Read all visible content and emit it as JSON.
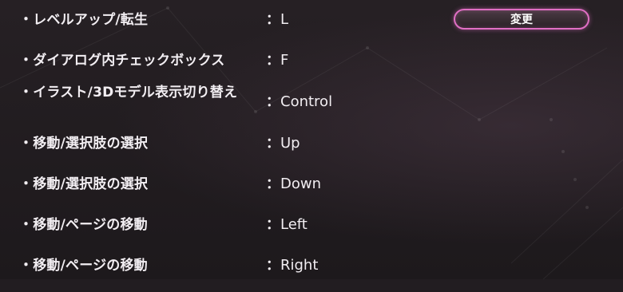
{
  "bindings": [
    {
      "action": "・レベルアップ/転生",
      "colon": "：",
      "key": "L"
    },
    {
      "action": "・ダイアログ内チェックボックス",
      "colon": "：",
      "key": "F"
    },
    {
      "action": "・イラスト/3Dモデル表示切り替え",
      "colon": "：",
      "key": "Control"
    },
    {
      "action": "・移動/選択肢の選択",
      "colon": "：",
      "key": "Up"
    },
    {
      "action": "・移動/選択肢の選択",
      "colon": "：",
      "key": "Down"
    },
    {
      "action": "・移動/ページの移動",
      "colon": "：",
      "key": "Left"
    },
    {
      "action": "・移動/ページの移動",
      "colon": "：",
      "key": "Right"
    }
  ],
  "change_button": {
    "label": "変更"
  },
  "colors": {
    "accent": "#e06fc4",
    "background": "#221d21",
    "text": "#f2eef2"
  }
}
